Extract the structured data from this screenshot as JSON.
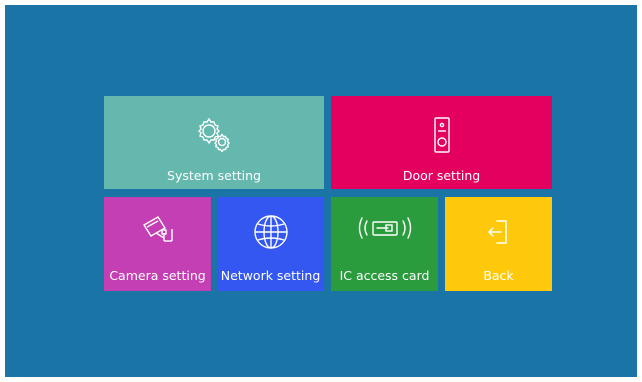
{
  "colors": {
    "background": "#1a74a5",
    "system": "#65b8ad",
    "door": "#e3005e",
    "camera": "#c33fb3",
    "network": "#3457f2",
    "ic": "#2a9c3d",
    "back": "#ffc90b",
    "text": "#ffffff"
  },
  "tiles": {
    "system": {
      "label": "System setting",
      "icon": "gears-icon"
    },
    "door": {
      "label": "Door setting",
      "icon": "doorbell-icon"
    },
    "camera": {
      "label": "Camera setting",
      "icon": "cctv-camera-icon"
    },
    "network": {
      "label": "Network setting",
      "icon": "globe-icon"
    },
    "ic": {
      "label": "IC access card",
      "icon": "rfid-card-icon"
    },
    "back": {
      "label": "Back",
      "icon": "exit-door-icon"
    }
  }
}
